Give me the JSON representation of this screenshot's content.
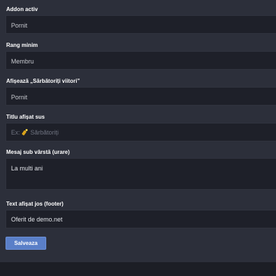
{
  "form": {
    "addon_active": {
      "label": "Addon activ",
      "value": "Pornit"
    },
    "min_rank": {
      "label": "Rang minim",
      "value": "Membru"
    },
    "show_upcoming": {
      "label": "Afișează „Sărbătoriți viitori”",
      "value": "Pornit"
    },
    "top_title": {
      "label": "Titlu afișat sus",
      "value": "",
      "placeholder_prefix": "Ex:",
      "placeholder_text": "Sărbătoriți",
      "placeholder_icon": "champagne-icon"
    },
    "age_message": {
      "label": "Mesaj sub vârstă (urare)",
      "value": "La multi ani"
    },
    "footer_text": {
      "label": "Text afișat jos (footer)",
      "value": "Oferit de demo.net"
    }
  },
  "actions": {
    "save_label": "Salveaza"
  },
  "colors": {
    "background": "#2c2f3a",
    "field_background": "#1e2029",
    "primary_button": "#5a7fc8",
    "footer_bar": "#1c1e25"
  }
}
